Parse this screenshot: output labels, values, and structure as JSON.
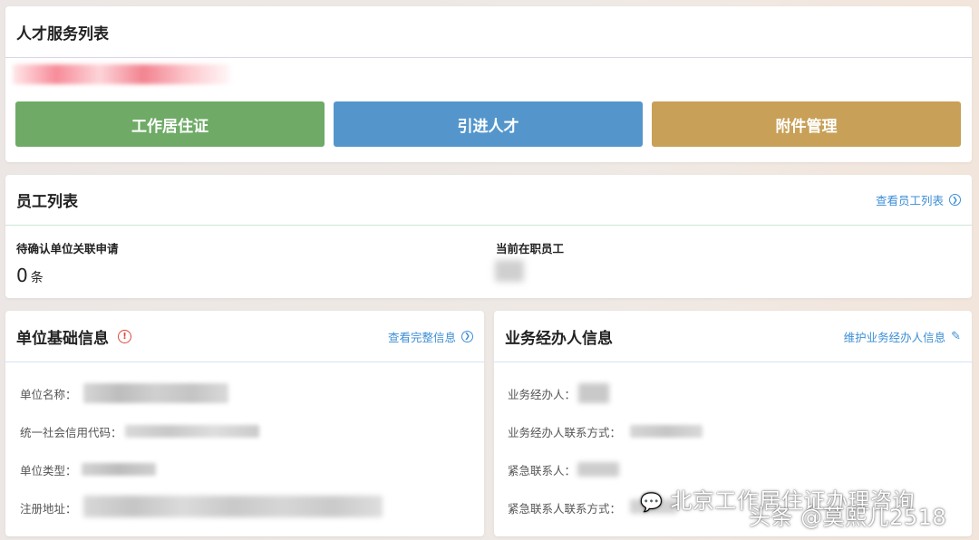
{
  "talent_section": {
    "title": "人才服务列表",
    "buttons": [
      {
        "label": "工作居住证",
        "color": "#6fab67"
      },
      {
        "label": "引进人才",
        "color": "#5496cc"
      },
      {
        "label": "附件管理",
        "color": "#c8a057"
      }
    ]
  },
  "staff_section": {
    "title": "员工列表",
    "link_label": "查看员工列表",
    "pending_label": "待确认单位关联申请",
    "pending_count": "0",
    "pending_unit": "条",
    "current_label": "当前在职员工"
  },
  "unit_section": {
    "title": "单位基础信息",
    "link_label": "查看完整信息",
    "fields": [
      {
        "label": "单位名称："
      },
      {
        "label": "统一社会信用代码："
      },
      {
        "label": "单位类型："
      },
      {
        "label": "注册地址："
      }
    ]
  },
  "agent_section": {
    "title": "业务经办人信息",
    "link_label": "维护业务经办人信息",
    "fields": [
      {
        "label": "业务经办人："
      },
      {
        "label": "业务经办人联系方式："
      },
      {
        "label": "紧急联系人："
      },
      {
        "label": "紧急联系人联系方式："
      }
    ]
  },
  "watermarks": {
    "line1": "北京工作居住证办理咨询",
    "line2": "头条 @莫熙儿2518"
  },
  "colors": {
    "link": "#3c8ed6",
    "warning": "#e0463c"
  }
}
